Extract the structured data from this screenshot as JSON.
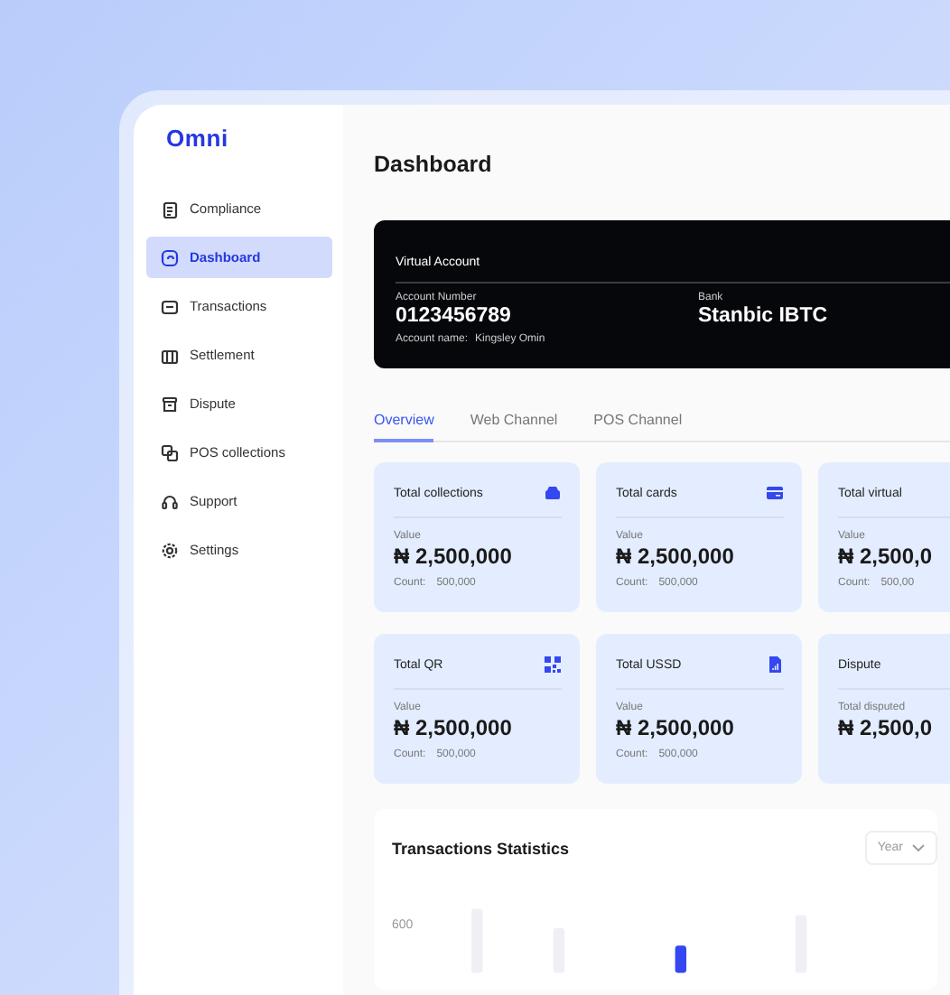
{
  "brand": "Omni",
  "sidebar": {
    "items": [
      {
        "label": "Compliance",
        "selected": false
      },
      {
        "label": "Dashboard",
        "selected": true
      },
      {
        "label": "Transactions",
        "selected": false
      },
      {
        "label": "Settlement",
        "selected": false
      },
      {
        "label": "Dispute",
        "selected": false
      },
      {
        "label": "POS collections",
        "selected": false
      },
      {
        "label": "Support",
        "selected": false
      },
      {
        "label": "Settings",
        "selected": false
      }
    ]
  },
  "page_title": "Dashboard",
  "virtual_account": {
    "title": "Virtual Account",
    "account_number_label": "Account Number",
    "account_number": "0123456789",
    "account_name_label": "Account name:",
    "account_name": "Kingsley Omin",
    "bank_label": "Bank",
    "bank": "Stanbic IBTC"
  },
  "tabs": [
    {
      "label": "Overview",
      "selected": true
    },
    {
      "label": "Web Channel",
      "selected": false
    },
    {
      "label": "POS  Channel",
      "selected": false
    }
  ],
  "cards": [
    {
      "title": "Total collections",
      "value_label": "Value",
      "value": "₦ 2,500,000",
      "count_label": "Count:",
      "count": "500,000"
    },
    {
      "title": "Total cards",
      "value_label": "Value",
      "value": "₦ 2,500,000",
      "count_label": "Count:",
      "count": "500,000"
    },
    {
      "title": "Total virtual",
      "value_label": "Value",
      "value": "₦ 2,500,0",
      "count_label": "Count:",
      "count": "500,00"
    },
    {
      "title": "Total QR",
      "value_label": "Value",
      "value": "₦ 2,500,000",
      "count_label": "Count:",
      "count": "500,000"
    },
    {
      "title": "Total USSD",
      "value_label": "Value",
      "value": "₦ 2,500,000",
      "count_label": "Count:",
      "count": "500,000"
    },
    {
      "title": "Dispute",
      "value_label": "Total disputed",
      "value": "₦ 2,500,0"
    }
  ],
  "statistics": {
    "title": "Transactions Statistics",
    "period": "Year",
    "y_tick": "600"
  }
}
